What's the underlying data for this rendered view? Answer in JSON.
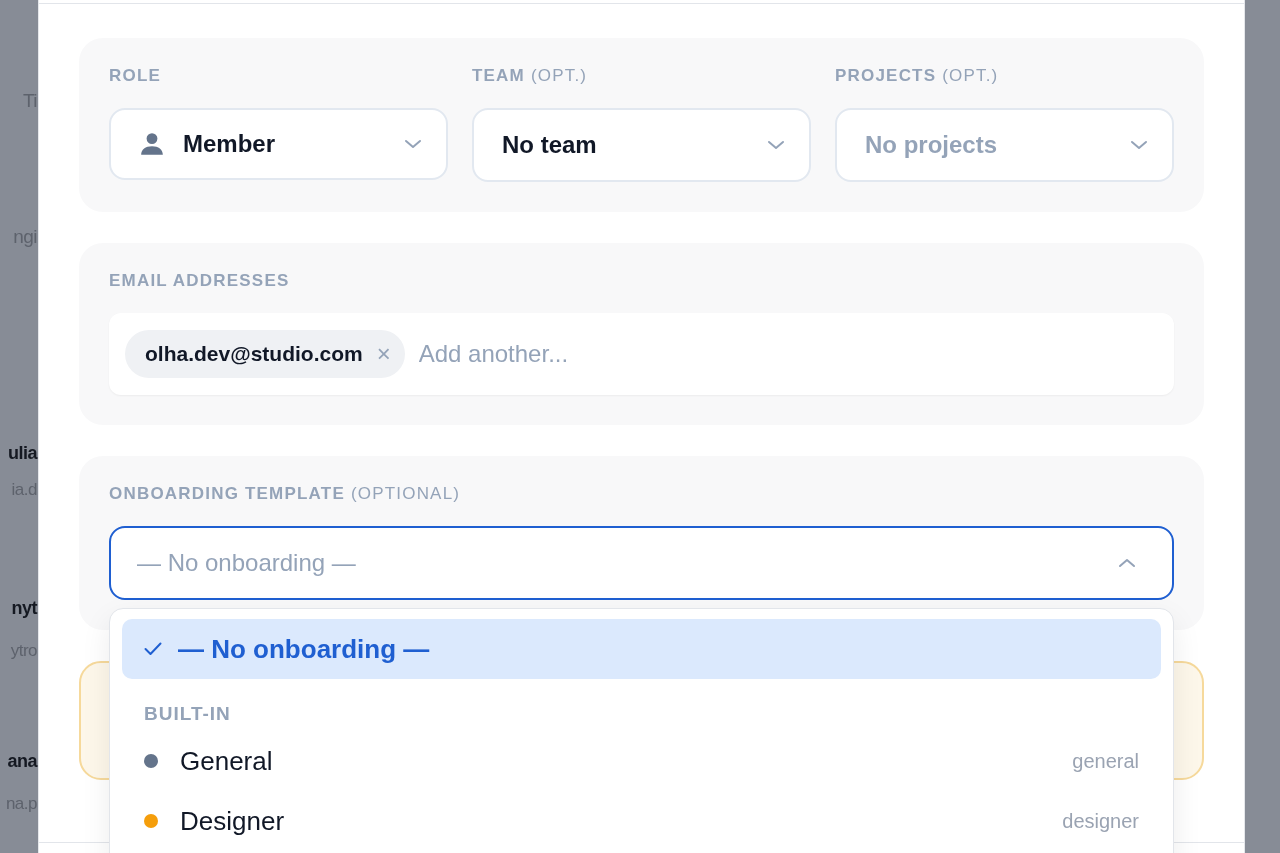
{
  "backdrop_texts": [
    {
      "kind": "heading",
      "text": "Ti"
    },
    {
      "kind": "heading",
      "text": "ngi"
    },
    {
      "kind": "name",
      "text": "ulia"
    },
    {
      "kind": "email",
      "text": "ia.d"
    },
    {
      "kind": "name",
      "text": "nyt"
    },
    {
      "kind": "email",
      "text": "ytro"
    },
    {
      "kind": "name",
      "text": "ana"
    },
    {
      "kind": "email",
      "text": "na.p"
    }
  ],
  "modal": {
    "access_fields": [
      {
        "label": "ROLE",
        "value": "Member",
        "muted": false
      },
      {
        "label": "TEAM",
        "suffix": "(OPT.)",
        "value": "No team",
        "muted": false
      },
      {
        "label": "PROJECTS",
        "suffix": "(OPT.)",
        "value": "No projects",
        "muted": true
      }
    ],
    "email_addresses": {
      "label": "EMAIL ADDRESSES",
      "chips": [
        {
          "text": "olha.dev@studio.com",
          "remove": "×"
        }
      ],
      "placeholder": "Add another..."
    },
    "onboarding_template": {
      "label": "ONBOARDING TEMPLATE",
      "suffix": "(OPTIONAL)",
      "value": "— No onboarding —",
      "expanded": true,
      "options": [
        {
          "kind": "option",
          "label": "— No onboarding —",
          "selected": true
        },
        {
          "kind": "group",
          "label": "BUILT-IN"
        },
        {
          "kind": "option",
          "label": "General",
          "slug": "general",
          "color": "#64748b",
          "selected": false
        },
        {
          "kind": "option",
          "label": "Designer",
          "slug": "designer",
          "color": "#f59e0b",
          "selected": false
        }
      ]
    },
    "notice": {
      "kind": "warning"
    }
  }
}
